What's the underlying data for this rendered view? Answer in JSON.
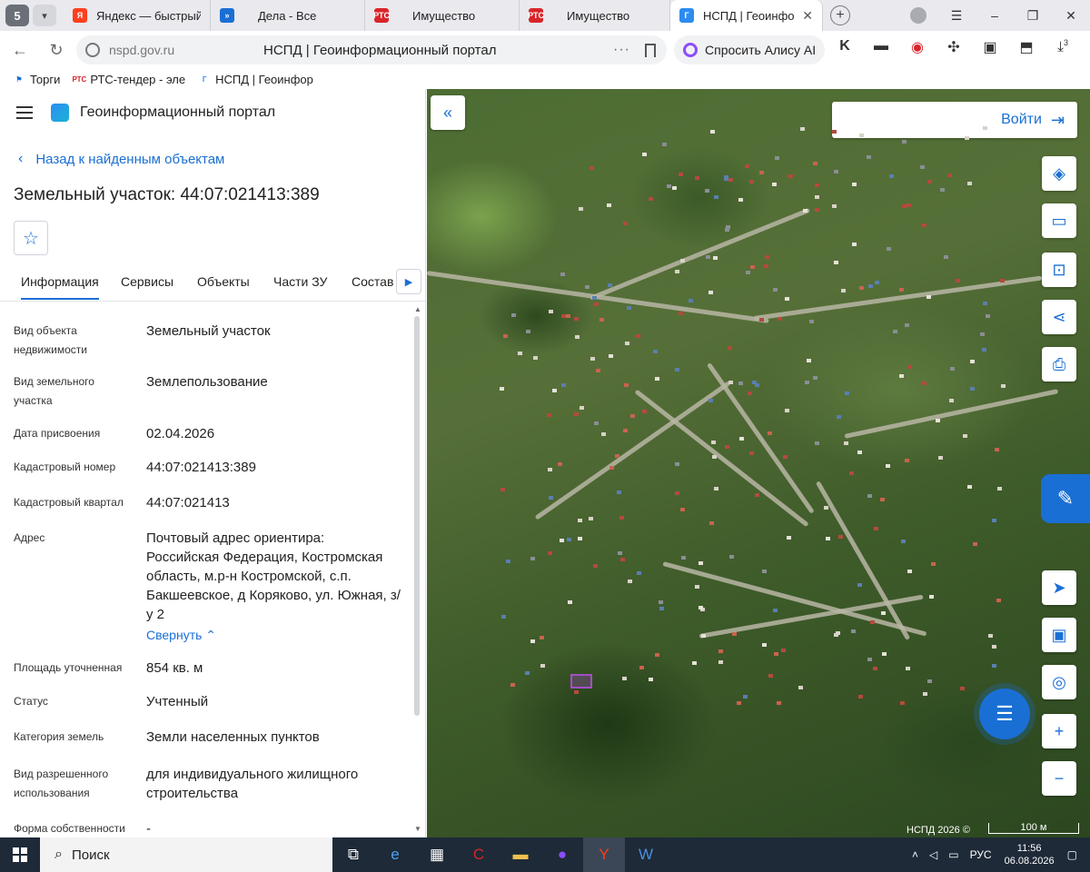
{
  "browser": {
    "tab_count": "5",
    "tabs": [
      {
        "title": "Яндекс — быстрый пои",
        "favicon": "Я",
        "color": "#fc3f1d"
      },
      {
        "title": "Дела - Все",
        "favicon": "»",
        "color": "#1a6fd4"
      },
      {
        "title": "Имущество",
        "favicon": "РТС",
        "color": "#d9252a"
      },
      {
        "title": "Имущество",
        "favicon": "РТС",
        "color": "#d9252a"
      },
      {
        "title": "НСПД | Геоинформ",
        "favicon": "Г",
        "color": "#2d8cf0",
        "active": true
      }
    ],
    "url_host": "nspd.gov.ru",
    "page_title": "НСПД | Геоинформационный портал",
    "alice_label": "Спросить Алису AI",
    "ext_badge": "3",
    "bookmarks": [
      {
        "label": "Торги",
        "favicon": "⚑"
      },
      {
        "label": "РТС-тендер - эле",
        "favicon": "РТС"
      },
      {
        "label": "НСПД | Геоинфор",
        "favicon": "Г"
      }
    ]
  },
  "portal": {
    "name": "Геоинформационный портал",
    "back_label": "Назад к найденным объектам",
    "object_title": "Земельный участок: 44:07:021413:389",
    "tabs": [
      "Информация",
      "Сервисы",
      "Объекты",
      "Части ЗУ",
      "Состав"
    ],
    "properties": [
      {
        "label": "Вид объекта недвижимости",
        "value": "Земельный участок"
      },
      {
        "label": "Вид земельного участка",
        "value": "Землепользование"
      },
      {
        "label": "Дата присвоения",
        "value": "02.04.2026"
      },
      {
        "label": "Кадастровый номер",
        "value": "44:07:021413:389"
      },
      {
        "label": "Кадастровый квартал",
        "value": "44:07:021413"
      },
      {
        "label": "Адрес",
        "value": "Почтовый адрес ориентира: Российская Федерация, Костромская область, м.р-н Костромской, с.п. Бакшеевское, д Коряково, ул. Южная, з/у 2",
        "link": "Свернуть"
      },
      {
        "label": "Площадь уточненная",
        "value": "854 кв. м"
      },
      {
        "label": "Статус",
        "value": "Учтенный"
      },
      {
        "label": "Категория земель",
        "value": "Земли населенных пунктов"
      },
      {
        "label": "Вид разрешенного использования",
        "value": "для индивидуального жилищного строительства"
      },
      {
        "label": "Форма собственности",
        "value": "-"
      }
    ]
  },
  "map": {
    "login_label": "Войти",
    "copyright": "НСПД 2026 ©",
    "scale_label": "100 м",
    "controls": [
      "layers-icon",
      "ruler-icon",
      "search-area-icon",
      "share-icon",
      "print-icon",
      "locate-icon",
      "minimap-icon",
      "geo-search-icon",
      "zoom-in-icon",
      "zoom-out-icon"
    ]
  },
  "taskbar": {
    "search_label": "Поиск",
    "lang": "РУС",
    "time": "11:56",
    "date": "06.08.2026"
  }
}
